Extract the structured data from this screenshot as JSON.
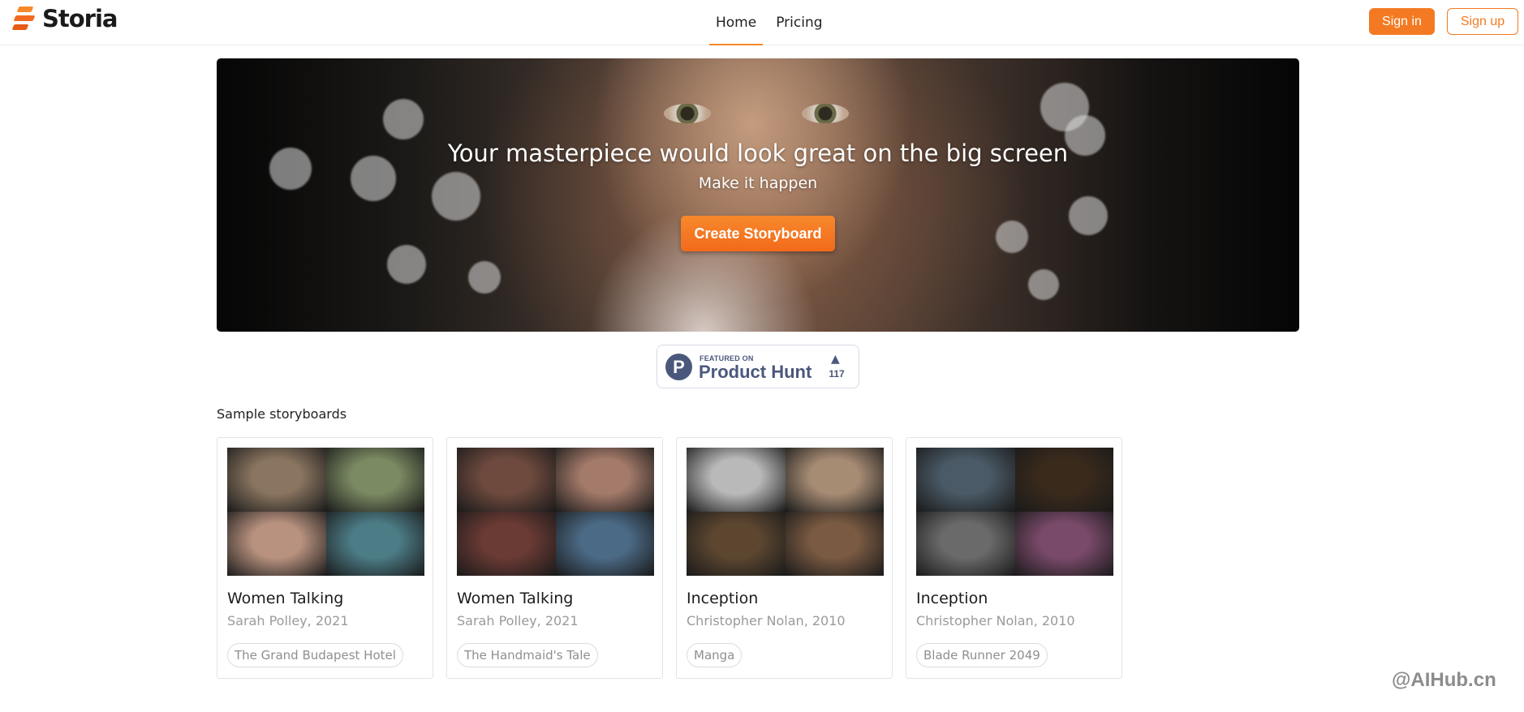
{
  "header": {
    "brand": "Storia",
    "nav": [
      {
        "label": "Home",
        "active": true
      },
      {
        "label": "Pricing",
        "active": false
      }
    ],
    "sign_in": "Sign in",
    "sign_up": "Sign up"
  },
  "hero": {
    "title": "Your masterpiece would look great on the big screen",
    "subtitle": "Make it happen",
    "cta": "Create Storyboard"
  },
  "product_hunt": {
    "featured_on": "FEATURED ON",
    "name": "Product Hunt",
    "logo_letter": "P",
    "upvote_arrow": "▲",
    "count": "117"
  },
  "samples": {
    "heading": "Sample storyboards",
    "cards": [
      {
        "title": "Women Talking",
        "subtitle": "Sarah Polley, 2021",
        "tag": "The Grand Budapest Hotel",
        "colors": [
          "#8a7560",
          "#7a8a62",
          "#b9927f",
          "#4c7c86"
        ]
      },
      {
        "title": "Women Talking",
        "subtitle": "Sarah Polley, 2021",
        "tag": "The Handmaid's Tale",
        "colors": [
          "#6e4a3e",
          "#a47a6a",
          "#6a3a34",
          "#4b6a86"
        ]
      },
      {
        "title": "Inception",
        "subtitle": "Christopher Nolan, 2010",
        "tag": "Manga",
        "colors": [
          "#b9b9b9",
          "#a78c74",
          "#5c4630",
          "#7a5a42"
        ]
      },
      {
        "title": "Inception",
        "subtitle": "Christopher Nolan, 2010",
        "tag": "Blade Runner 2049",
        "colors": [
          "#4a5a66",
          "#3a2a1c",
          "#6a6a6a",
          "#7a4a6a"
        ]
      }
    ]
  },
  "watermark": "@AIHub.cn"
}
